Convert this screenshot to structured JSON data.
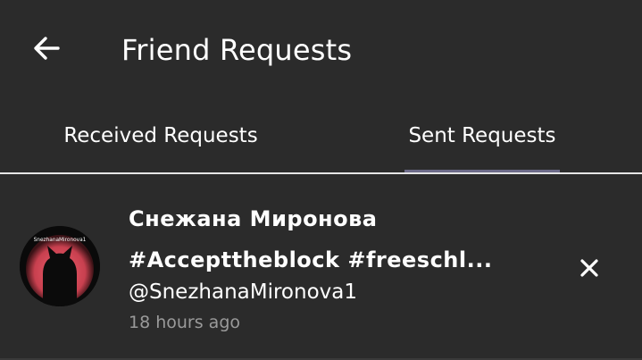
{
  "header": {
    "title": "Friend Requests",
    "back_icon": "arrow-left-icon"
  },
  "tabs": [
    {
      "label": "Received Requests",
      "active": false
    },
    {
      "label": "Sent Requests",
      "active": true
    }
  ],
  "requests": [
    {
      "name_line1": "Снежана Миронова",
      "name_line2": "#Accepttheblock #freeschl...",
      "handle": "@SnezhanaMironova1",
      "time": "18 hours ago",
      "avatar_caption": "SnezhanaMironova1",
      "cancel_icon": "close-icon"
    }
  ],
  "colors": {
    "background": "#2b2b2b",
    "text": "#ffffff",
    "muted_text": "#9a9a9a",
    "tab_indicator": "#6e6c8a",
    "avatar_accent": "#e0505f"
  }
}
